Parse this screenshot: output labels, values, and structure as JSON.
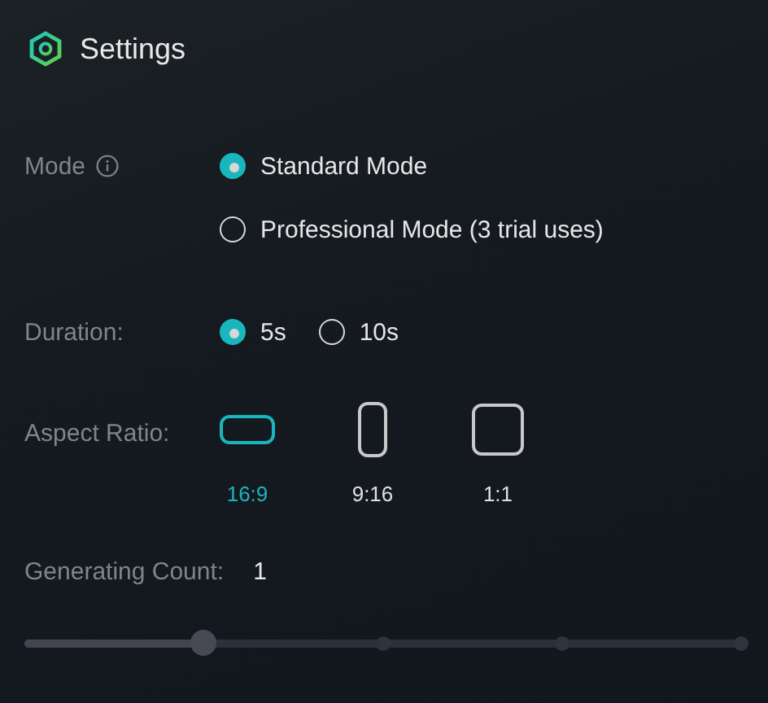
{
  "header": {
    "title": "Settings"
  },
  "mode": {
    "label": "Mode",
    "options": [
      {
        "label": "Standard Mode",
        "selected": true
      },
      {
        "label": "Professional Mode (3 trial uses)",
        "selected": false
      }
    ]
  },
  "duration": {
    "label": "Duration:",
    "options": [
      {
        "label": "5s",
        "selected": true
      },
      {
        "label": "10s",
        "selected": false
      }
    ]
  },
  "aspect_ratio": {
    "label": "Aspect Ratio:",
    "options": [
      {
        "label": "16:9",
        "kind": "landscape",
        "selected": true
      },
      {
        "label": "9:16",
        "kind": "portrait",
        "selected": false
      },
      {
        "label": "1:1",
        "kind": "square",
        "selected": false
      }
    ]
  },
  "generating_count": {
    "label": "Generating Count:",
    "value": "1",
    "level": 0.25
  }
}
